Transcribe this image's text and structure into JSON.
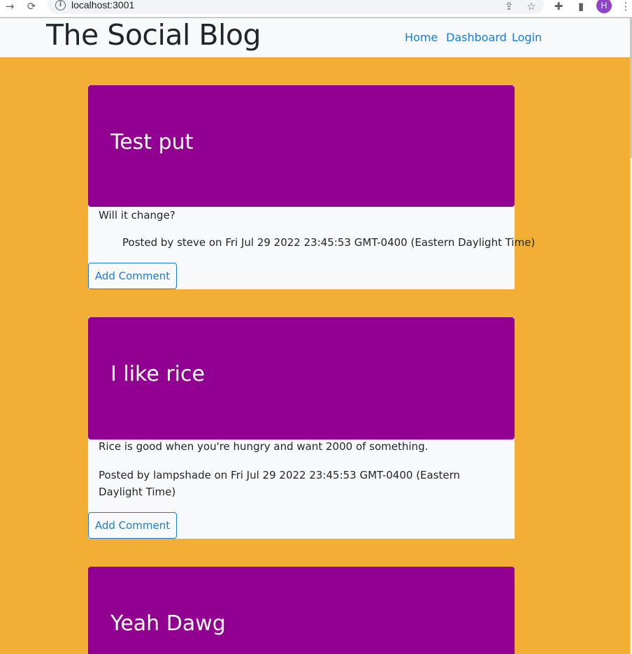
{
  "browser": {
    "url": "localhost:3001",
    "avatar_initial": "H"
  },
  "navbar": {
    "brand": "The Social Blog",
    "links": [
      "Home",
      "Dashboard",
      "Login"
    ]
  },
  "posts": [
    {
      "title": "Test put",
      "body": "Will it change?",
      "meta": "Posted by steve on Fri Jul 29 2022 23:45:53 GMT-0400 (Eastern Daylight Time)",
      "button": "Add Comment"
    },
    {
      "title": "I like rice",
      "body": "Rice is good when you're hungry and want 2000 of something.",
      "meta": "Posted by lampshade on Fri Jul 29 2022 23:45:53 GMT-0400 (Eastern Daylight Time)",
      "button": "Add Comment"
    },
    {
      "title": "Yeah Dawg"
    }
  ],
  "colors": {
    "page_background": "#f2ae35",
    "post_header": "#910090",
    "link": "#1a7bd6"
  }
}
